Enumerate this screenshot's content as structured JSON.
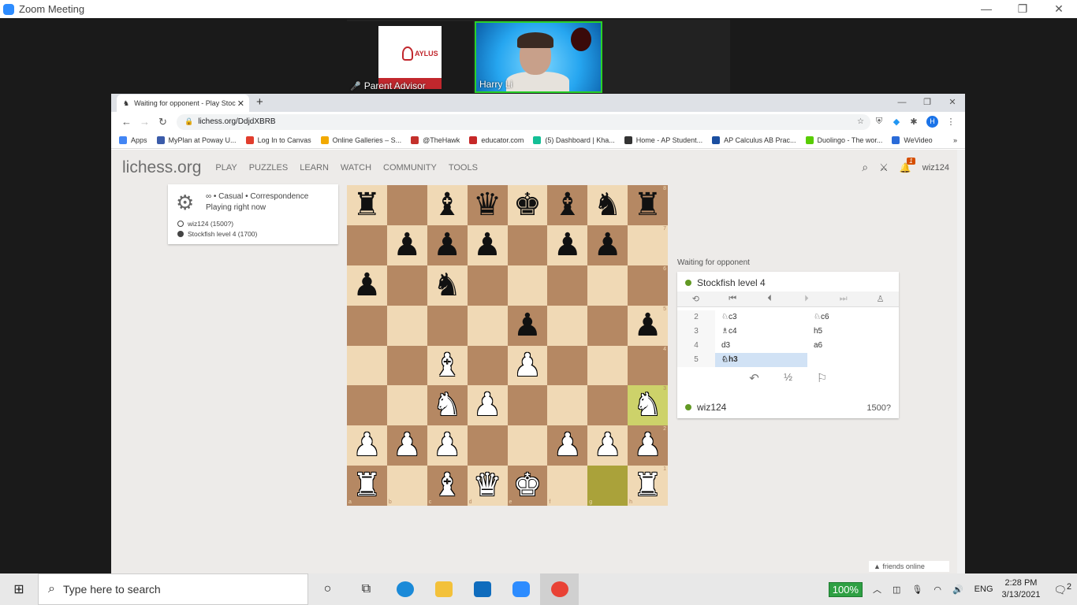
{
  "zoom": {
    "window_title": "Zoom Meeting",
    "participants": [
      {
        "name": "Parent Advisor",
        "poster_text": "AYLUS"
      },
      {
        "name": "Harry Li"
      }
    ]
  },
  "browser": {
    "tab_title": "Waiting for opponent - Play Stoc",
    "url": "lichess.org/DdjdXBRB",
    "profile_initial": "H",
    "bookmarks": [
      {
        "label": "Apps",
        "color": "#4285f4"
      },
      {
        "label": "MyPlan at Poway U...",
        "color": "#3b5ba9"
      },
      {
        "label": "Log In to Canvas",
        "color": "#e13d2d"
      },
      {
        "label": "Online Galleries – S...",
        "color": "#f2a900"
      },
      {
        "label": "@TheHawk",
        "color": "#c4302b"
      },
      {
        "label": "educator.com",
        "color": "#c62828"
      },
      {
        "label": "(5) Dashboard | Kha...",
        "color": "#14bf96"
      },
      {
        "label": "Home - AP Student...",
        "color": "#333333"
      },
      {
        "label": "AP Calculus AB Prac...",
        "color": "#1a4ea0"
      },
      {
        "label": "Duolingo - The wor...",
        "color": "#58cc02"
      },
      {
        "label": "WeVideo",
        "color": "#2a6bd8"
      }
    ],
    "more_bookmarks": "»"
  },
  "lichess": {
    "logo": "lichess",
    "logo_tld": ".org",
    "nav": [
      "PLAY",
      "PUZZLES",
      "LEARN",
      "WATCH",
      "COMMUNITY",
      "TOOLS"
    ],
    "username": "wiz124",
    "notification_count": "1",
    "game_info": {
      "line1": "∞ • Casual • Correspondence",
      "line2": "Playing right now",
      "white_player": "wiz124 (1500?)",
      "black_player": "Stockfish level 4 (1700)"
    },
    "status": "Waiting for opponent",
    "opponent": "Stockfish level 4",
    "me": "wiz124",
    "my_rating": "1500?",
    "moves": [
      {
        "num": "2",
        "white": "♘c3",
        "black": "♘c6"
      },
      {
        "num": "3",
        "white": "♗c4",
        "black": "h5"
      },
      {
        "num": "4",
        "white": "d3",
        "black": "a6"
      },
      {
        "num": "5",
        "white": "♘h3",
        "black": ""
      }
    ],
    "active_move": 3,
    "draw_label": "½",
    "friends": "▲ friends online",
    "files": [
      "a",
      "b",
      "c",
      "d",
      "e",
      "f",
      "g",
      "h"
    ],
    "ranks": [
      "8",
      "7",
      "6",
      "5",
      "4",
      "3",
      "2",
      "1"
    ],
    "board": [
      [
        "r",
        "",
        "b",
        "q",
        "k",
        "b",
        "n",
        "r"
      ],
      [
        "",
        "p",
        "p",
        "p",
        "",
        "p",
        "p",
        ""
      ],
      [
        "p",
        "",
        "n",
        "",
        "",
        "",
        "",
        ""
      ],
      [
        "",
        "",
        "",
        "",
        "p",
        "",
        "",
        "p"
      ],
      [
        "",
        "",
        "B",
        "",
        "P",
        "",
        "",
        ""
      ],
      [
        "",
        "",
        "N",
        "P",
        "",
        "",
        "",
        "N"
      ],
      [
        "P",
        "P",
        "P",
        "",
        "",
        "P",
        "P",
        "P"
      ],
      [
        "R",
        "",
        "B",
        "Q",
        "K",
        "",
        "",
        "R"
      ]
    ],
    "last_move": [
      "g1",
      "h3"
    ]
  },
  "taskbar": {
    "search_placeholder": "Type here to search",
    "battery": "100%",
    "language": "ENG",
    "time": "2:28 PM",
    "date": "3/13/2021",
    "notifications": "2"
  }
}
